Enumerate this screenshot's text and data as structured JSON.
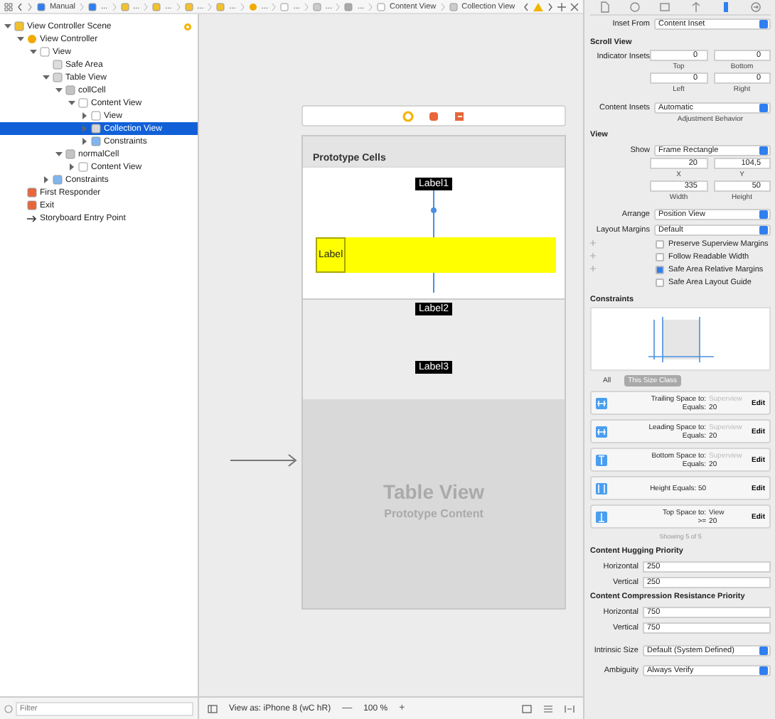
{
  "breadcrumb": {
    "items": [
      {
        "kind": "storyboard",
        "label": "Manual"
      },
      {
        "kind": "file",
        "label": "..."
      },
      {
        "kind": "folder",
        "label": "..."
      },
      {
        "kind": "doc",
        "label": "..."
      },
      {
        "kind": "doc",
        "label": "..."
      },
      {
        "kind": "scene",
        "label": "..."
      },
      {
        "kind": "controller",
        "label": "..."
      },
      {
        "kind": "view",
        "label": "..."
      },
      {
        "kind": "table",
        "label": "..."
      },
      {
        "kind": "cell",
        "label": "..."
      },
      {
        "kind": "view",
        "label": "Content View"
      },
      {
        "kind": "table",
        "label": "Collection View"
      }
    ]
  },
  "outline": {
    "filter_placeholder": "Filter",
    "nodes": [
      {
        "label": "View Controller Scene",
        "kind": "scene",
        "disclosure": true,
        "expanded": true,
        "selected": false,
        "badge": true,
        "children": [
          {
            "label": "View Controller",
            "kind": "controller",
            "disclosure": true,
            "expanded": true,
            "selected": false,
            "badge": false,
            "children": [
              {
                "label": "View",
                "kind": "view",
                "disclosure": true,
                "expanded": true,
                "selected": false,
                "badge": false,
                "children": [
                  {
                    "label": "Safe Area",
                    "kind": "safearea",
                    "disclosure": false,
                    "expanded": false,
                    "selected": false,
                    "badge": false
                  },
                  {
                    "label": "Table View",
                    "kind": "table",
                    "disclosure": true,
                    "expanded": true,
                    "selected": false,
                    "badge": false,
                    "children": [
                      {
                        "label": "collCell",
                        "kind": "cell",
                        "disclosure": true,
                        "expanded": true,
                        "selected": false,
                        "badge": false,
                        "children": [
                          {
                            "label": "Content View",
                            "kind": "view",
                            "disclosure": true,
                            "expanded": true,
                            "selected": false,
                            "badge": false,
                            "children": [
                              {
                                "label": "View",
                                "kind": "view",
                                "disclosure": true,
                                "expanded": false,
                                "selected": false,
                                "badge": false
                              },
                              {
                                "label": "Collection View",
                                "kind": "table",
                                "disclosure": true,
                                "expanded": false,
                                "selected": true,
                                "badge": false
                              },
                              {
                                "label": "Constraints",
                                "kind": "constraints",
                                "disclosure": true,
                                "expanded": false,
                                "selected": false,
                                "badge": false
                              }
                            ]
                          }
                        ]
                      },
                      {
                        "label": "normalCell",
                        "kind": "cell",
                        "disclosure": true,
                        "expanded": true,
                        "selected": false,
                        "badge": false,
                        "children": [
                          {
                            "label": "Content View",
                            "kind": "view",
                            "disclosure": true,
                            "expanded": false,
                            "selected": false,
                            "badge": false
                          }
                        ]
                      }
                    ]
                  },
                  {
                    "label": "Constraints",
                    "kind": "constraints",
                    "disclosure": true,
                    "expanded": false,
                    "selected": false,
                    "badge": false
                  }
                ]
              }
            ]
          },
          {
            "label": "First Responder",
            "kind": "responder",
            "disclosure": false,
            "expanded": false,
            "selected": false,
            "badge": false
          },
          {
            "label": "Exit",
            "kind": "exit",
            "disclosure": false,
            "expanded": false,
            "selected": false,
            "badge": false
          },
          {
            "label": "Storyboard Entry Point",
            "kind": "entry",
            "disclosure": false,
            "expanded": false,
            "selected": false,
            "badge": false
          }
        ]
      }
    ]
  },
  "canvas": {
    "header": "Prototype Cells",
    "labels": [
      "Label1",
      "Label",
      "Label2",
      "Label3"
    ],
    "title": "Table View",
    "subtitle": "Prototype Content"
  },
  "canvas_bar": {
    "view_as": "View as: iPhone 8 (wC hR)",
    "zoom_out": "—",
    "zoom": "100 %",
    "zoom_in": "+"
  },
  "inspector": {
    "tabs": [
      {
        "kind": "file",
        "selected": false
      },
      {
        "kind": "help",
        "selected": false
      },
      {
        "kind": "identity",
        "selected": false
      },
      {
        "kind": "attributes",
        "selected": false
      },
      {
        "kind": "size",
        "selected": true
      },
      {
        "kind": "connections",
        "selected": false
      }
    ],
    "inset_from": {
      "label": "Inset From",
      "value": "Content Inset"
    },
    "scroll_view": {
      "title": "Scroll View",
      "indicator_label": "Indicator Insets",
      "indicator_insets": [
        {
          "value": "0",
          "caption": "Top"
        },
        {
          "value": "0",
          "caption": "Bottom"
        },
        {
          "value": "0",
          "caption": "Left"
        },
        {
          "value": "0",
          "caption": "Right"
        }
      ],
      "content_insets": {
        "label": "Content Insets",
        "value": "Automatic",
        "caption": "Adjustment Behavior"
      }
    },
    "view": {
      "title": "View",
      "show": {
        "label": "Show",
        "value": "Frame Rectangle"
      },
      "frame": [
        {
          "value": "20",
          "caption": "X"
        },
        {
          "value": "104,5",
          "caption": "Y"
        },
        {
          "value": "335",
          "caption": "Width"
        },
        {
          "value": "50",
          "caption": "Height"
        }
      ],
      "arrange": {
        "label": "Arrange",
        "value": "Position View"
      },
      "layout_margins": {
        "label": "Layout Margins",
        "value": "Default"
      },
      "options": [
        {
          "label": "Preserve Superview Margins",
          "checked": false,
          "plus": true
        },
        {
          "label": "Follow Readable Width",
          "checked": false,
          "plus": true
        },
        {
          "label": "Safe Area Relative Margins",
          "checked": true,
          "plus": true
        },
        {
          "label": "Safe Area Layout Guide",
          "checked": false,
          "plus": false
        }
      ]
    },
    "constraints": {
      "title": "Constraints",
      "filters": [
        {
          "label": "All",
          "selected": false
        },
        {
          "label": "This Size Class",
          "selected": true
        }
      ],
      "items": [
        {
          "kind": "trailing",
          "label": "Trailing Space to:",
          "target": "Superview",
          "target_dim": true,
          "relation": "Equals:",
          "value": "20",
          "action": "Edit"
        },
        {
          "kind": "leading",
          "label": "Leading Space to:",
          "target": "Superview",
          "target_dim": true,
          "relation": "Equals:",
          "value": "20",
          "action": "Edit"
        },
        {
          "kind": "bottom",
          "label": "Bottom Space to:",
          "target": "Superview",
          "target_dim": true,
          "relation": "Equals:",
          "value": "20",
          "action": "Edit"
        },
        {
          "kind": "height",
          "label": "Height Equals:",
          "value": "50",
          "action": "Edit"
        },
        {
          "kind": "top",
          "label": "Top Space to:",
          "target": "View",
          "target_dim": false,
          "relation": ">=",
          "value": "20",
          "action": "Edit"
        }
      ],
      "footer": "Showing 5 of 5"
    },
    "hugging": {
      "title": "Content Hugging Priority",
      "rows": [
        {
          "label": "Horizontal",
          "value": "250"
        },
        {
          "label": "Vertical",
          "value": "250"
        }
      ]
    },
    "compression": {
      "title": "Content Compression Resistance Priority",
      "rows": [
        {
          "label": "Horizontal",
          "value": "750"
        },
        {
          "label": "Vertical",
          "value": "750"
        }
      ]
    },
    "intrinsic_size": {
      "label": "Intrinsic Size",
      "value": "Default (System Defined)"
    },
    "ambiguity": {
      "label": "Ambiguity",
      "value": "Always Verify"
    }
  }
}
